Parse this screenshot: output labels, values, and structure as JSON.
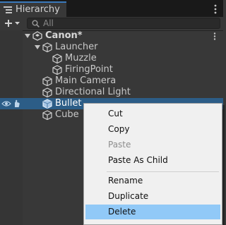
{
  "window": {
    "tab_label": "Hierarchy"
  },
  "toolbar": {
    "search_placeholder": "All"
  },
  "tree": {
    "scene": {
      "label": "Canon*"
    },
    "items": [
      {
        "label": "Launcher"
      },
      {
        "label": "Muzzle"
      },
      {
        "label": "FiringPoint"
      },
      {
        "label": "Main Camera"
      },
      {
        "label": "Directional Light"
      },
      {
        "label": "Bullet"
      },
      {
        "label": "Cube"
      }
    ],
    "selected": "Bullet"
  },
  "context_menu": {
    "items": [
      {
        "label": "Cut",
        "enabled": true
      },
      {
        "label": "Copy",
        "enabled": true
      },
      {
        "label": "Paste",
        "enabled": false
      },
      {
        "label": "Paste As Child",
        "enabled": true
      },
      {
        "label": "Rename",
        "enabled": true
      },
      {
        "label": "Duplicate",
        "enabled": true
      },
      {
        "label": "Delete",
        "enabled": true,
        "highlighted": true
      }
    ]
  },
  "colors": {
    "selection": "#2c5d87",
    "menu_highlight": "#91c9f7",
    "tab_accent": "#3a79bb"
  },
  "icons": [
    "hierarchy-icon",
    "kebab-menu-icon",
    "plus-icon",
    "dropdown-arrow-icon",
    "search-icon",
    "unity-scene-icon",
    "gameobject-cube-icon",
    "visibility-eye-icon",
    "pickability-hand-icon",
    "foldout-arrow-icon"
  ]
}
